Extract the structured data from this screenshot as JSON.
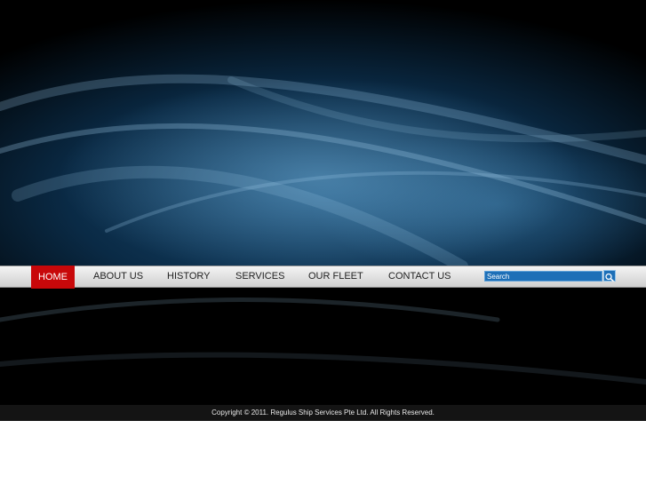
{
  "nav": {
    "items": [
      {
        "label": "HOME",
        "active": true
      },
      {
        "label": "ABOUT US",
        "active": false
      },
      {
        "label": "HISTORY",
        "active": false
      },
      {
        "label": "SERVICES",
        "active": false
      },
      {
        "label": "OUR FLEET",
        "active": false
      },
      {
        "label": "CONTACT US",
        "active": false
      }
    ],
    "active_color": "#c8080a"
  },
  "search": {
    "placeholder": "Search",
    "icon": "search-icon",
    "color": "#1d6fb7"
  },
  "footer": {
    "copyright": "Copyright © 2011. Regulus Ship Services Pte Ltd. All Rights Reserved."
  }
}
